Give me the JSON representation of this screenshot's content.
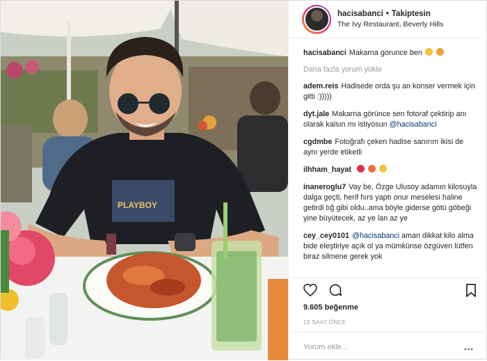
{
  "post": {
    "username": "hacisabanci",
    "separator": "•",
    "follow_label": "Takiptesin",
    "location": "The Ivy Restaurant, Beverly Hills"
  },
  "caption": {
    "author": "hacisabanci",
    "text": "Makarna gorunce ben"
  },
  "load_more_label": "Daha fazla yorum yükle",
  "comments": [
    {
      "author": "adem.reis",
      "text": "Hadisede orda şu an konser vermek için gitti :)))))"
    },
    {
      "author": "dyt.jale",
      "text": "Makarna görünce sen fotoraf çektirip anı olarak kalsın mı istiyosun",
      "mention": "@hacisabanci"
    },
    {
      "author": "cgdmbe",
      "text": "Fotoğrafı çeken hadise sanırım ikisi de aynı yerde etiketli"
    },
    {
      "author": "ilhham_hayat",
      "text": ""
    },
    {
      "author": "inaneroglu7",
      "text": "Vay be, Özge Ulusoy adamın kilosuyla dalga geçti, herif hırs yaptı onur meselesi haline getirdi tığ gibi oldu..ama böyle giderse götü göbeği yine büyütecek, az ye lan az ye"
    },
    {
      "author": "cey_cey0101",
      "mention": "@hacisabanci",
      "text": "aman dikkat kilo alma bide eleştiriye açık ol ya mümkünse özgüven lütfen biraz silmene gerek yok"
    }
  ],
  "actions": {
    "like_icon": "heart-icon",
    "comment_icon": "comment-icon",
    "save_icon": "bookmark-icon"
  },
  "likes": "9.605 beğenme",
  "timestamp": "19 SAAT ÖNCE",
  "add_comment": {
    "placeholder": "Yorum ekle...",
    "more_label": "..."
  },
  "colors": {
    "text": "#262626",
    "muted": "#999999",
    "mention": "#003569",
    "border": "#efefef"
  }
}
